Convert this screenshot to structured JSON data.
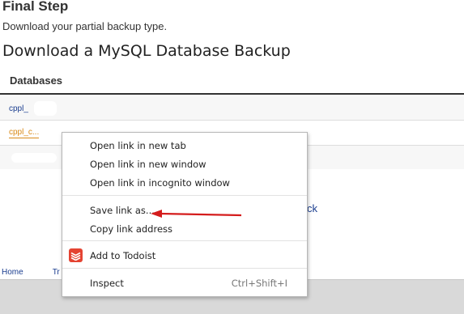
{
  "page": {
    "title": "Final Step",
    "subtitle": "Download your partial backup type.",
    "section_heading": "Download a MySQL Database Backup"
  },
  "table": {
    "header": "Databases",
    "rows": [
      "cppl_",
      "cppl_c..."
    ]
  },
  "background": {
    "partial_link": "ck",
    "footer_links": [
      "Home",
      "Tr"
    ]
  },
  "context_menu": {
    "items": [
      {
        "label": "Open link in new tab"
      },
      {
        "label": "Open link in new window"
      },
      {
        "label": "Open link in incognito window"
      },
      {
        "label": "Save link as..."
      },
      {
        "label": "Copy link address"
      },
      {
        "label": "Add to Todoist",
        "icon": "todoist-icon"
      },
      {
        "label": "Inspect",
        "shortcut": "Ctrl+Shift+I"
      }
    ]
  },
  "colors": {
    "annotation_arrow": "#d41c1c",
    "todoist": "#e44332",
    "link_blue": "#1a3d8f",
    "link_orange": "#d98b1a"
  }
}
